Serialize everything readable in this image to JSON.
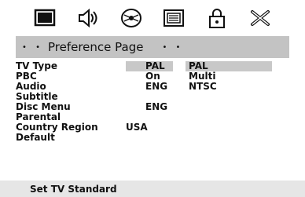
{
  "toolbar": {
    "icons": [
      "monitor-icon",
      "speaker-icon",
      "disc-icon",
      "screen-menu-icon",
      "lock-icon",
      "tools-icon"
    ]
  },
  "page": {
    "dots_left": "• •",
    "title": "Preference Page",
    "dots_right": "• •"
  },
  "settings": [
    {
      "label": "TV Type",
      "value": "PAL"
    },
    {
      "label": "PBC",
      "value": "On"
    },
    {
      "label": "Audio",
      "value": "ENG"
    },
    {
      "label": "Subtitle",
      "value": ""
    },
    {
      "label": "Disc Menu",
      "value": "ENG"
    },
    {
      "label": "Parental",
      "value": ""
    },
    {
      "label": "Country Region",
      "value": "USA"
    },
    {
      "label": "Default",
      "value": ""
    }
  ],
  "options": [
    "PAL",
    "Multi",
    "NTSC"
  ],
  "hint": "Set TV Standard",
  "colors": {
    "title_bar": "#c3c3c3",
    "highlight": "#c8c8c8",
    "hint_bar": "#e6e6e6"
  }
}
